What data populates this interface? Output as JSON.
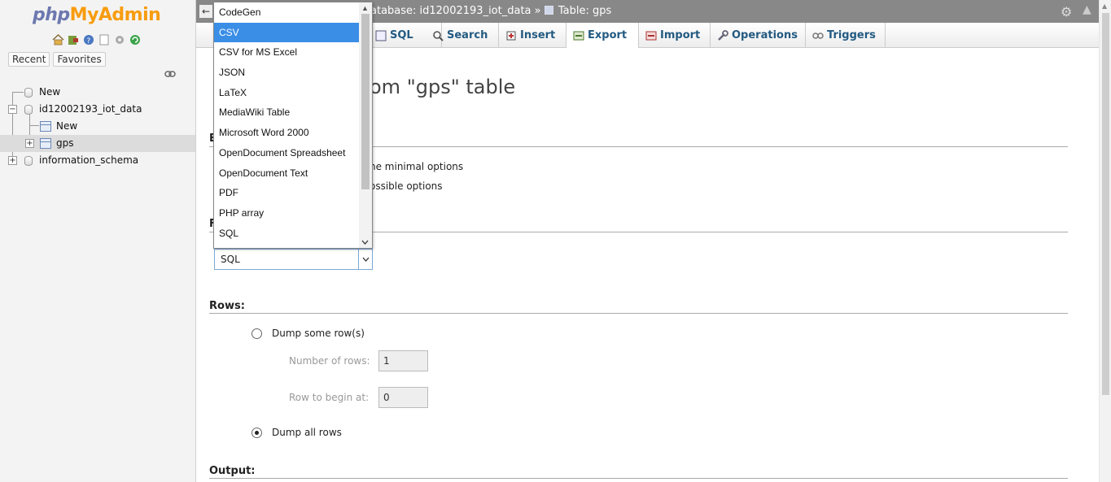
{
  "nav": {
    "logo_php": "php",
    "logo_my": "My",
    "logo_admin": "Admin",
    "recent": "Recent",
    "favorites": "Favorites",
    "icons": [
      "home-icon",
      "exit-icon",
      "help-icon",
      "docs-icon",
      "settings-icon",
      "reload-icon"
    ],
    "tree": {
      "new_top": "New",
      "db1": "id12002193_iot_data",
      "db1_new": "New",
      "table_gps": "gps",
      "db2": "information_schema"
    }
  },
  "topbar": {
    "back": "←",
    "breadcrumb_db": "atabase: id12002193_iot_data »",
    "breadcrumb_table": "Table: gps"
  },
  "tabs": [
    {
      "label": "SQL",
      "icon": "sql-icon"
    },
    {
      "label": "Search",
      "icon": "search-icon"
    },
    {
      "label": "Insert",
      "icon": "insert-icon"
    },
    {
      "label": "Export",
      "icon": "export-icon",
      "active": true
    },
    {
      "label": "Import",
      "icon": "import-icon"
    },
    {
      "label": "Operations",
      "icon": "wrench-icon"
    },
    {
      "label": "Triggers",
      "icon": "triggers-icon"
    }
  ],
  "main": {
    "title_fragment": "om \"gps\" table",
    "export_method_head": "E",
    "opt_quick": "he minimal options",
    "opt_custom": "ossible options",
    "format_head": "F",
    "format_selected": "SQL",
    "rows_head": "Rows:",
    "dump_some": "Dump some row(s)",
    "num_rows_label": "Number of rows:",
    "num_rows_value": "1",
    "begin_label": "Row to begin at:",
    "begin_value": "0",
    "dump_all": "Dump all rows",
    "output_head": "Output:"
  },
  "dropdown": {
    "items": [
      "CodeGen",
      "CSV",
      "CSV for MS Excel",
      "JSON",
      "LaTeX",
      "MediaWiki Table",
      "Microsoft Word 2000",
      "OpenDocument Spreadsheet",
      "OpenDocument Text",
      "PDF",
      "PHP array",
      "SQL"
    ],
    "highlighted": "CSV"
  },
  "colors": {
    "tab_text": "#235a81",
    "highlight": "#3a8ee6",
    "topbar": "#888888"
  }
}
